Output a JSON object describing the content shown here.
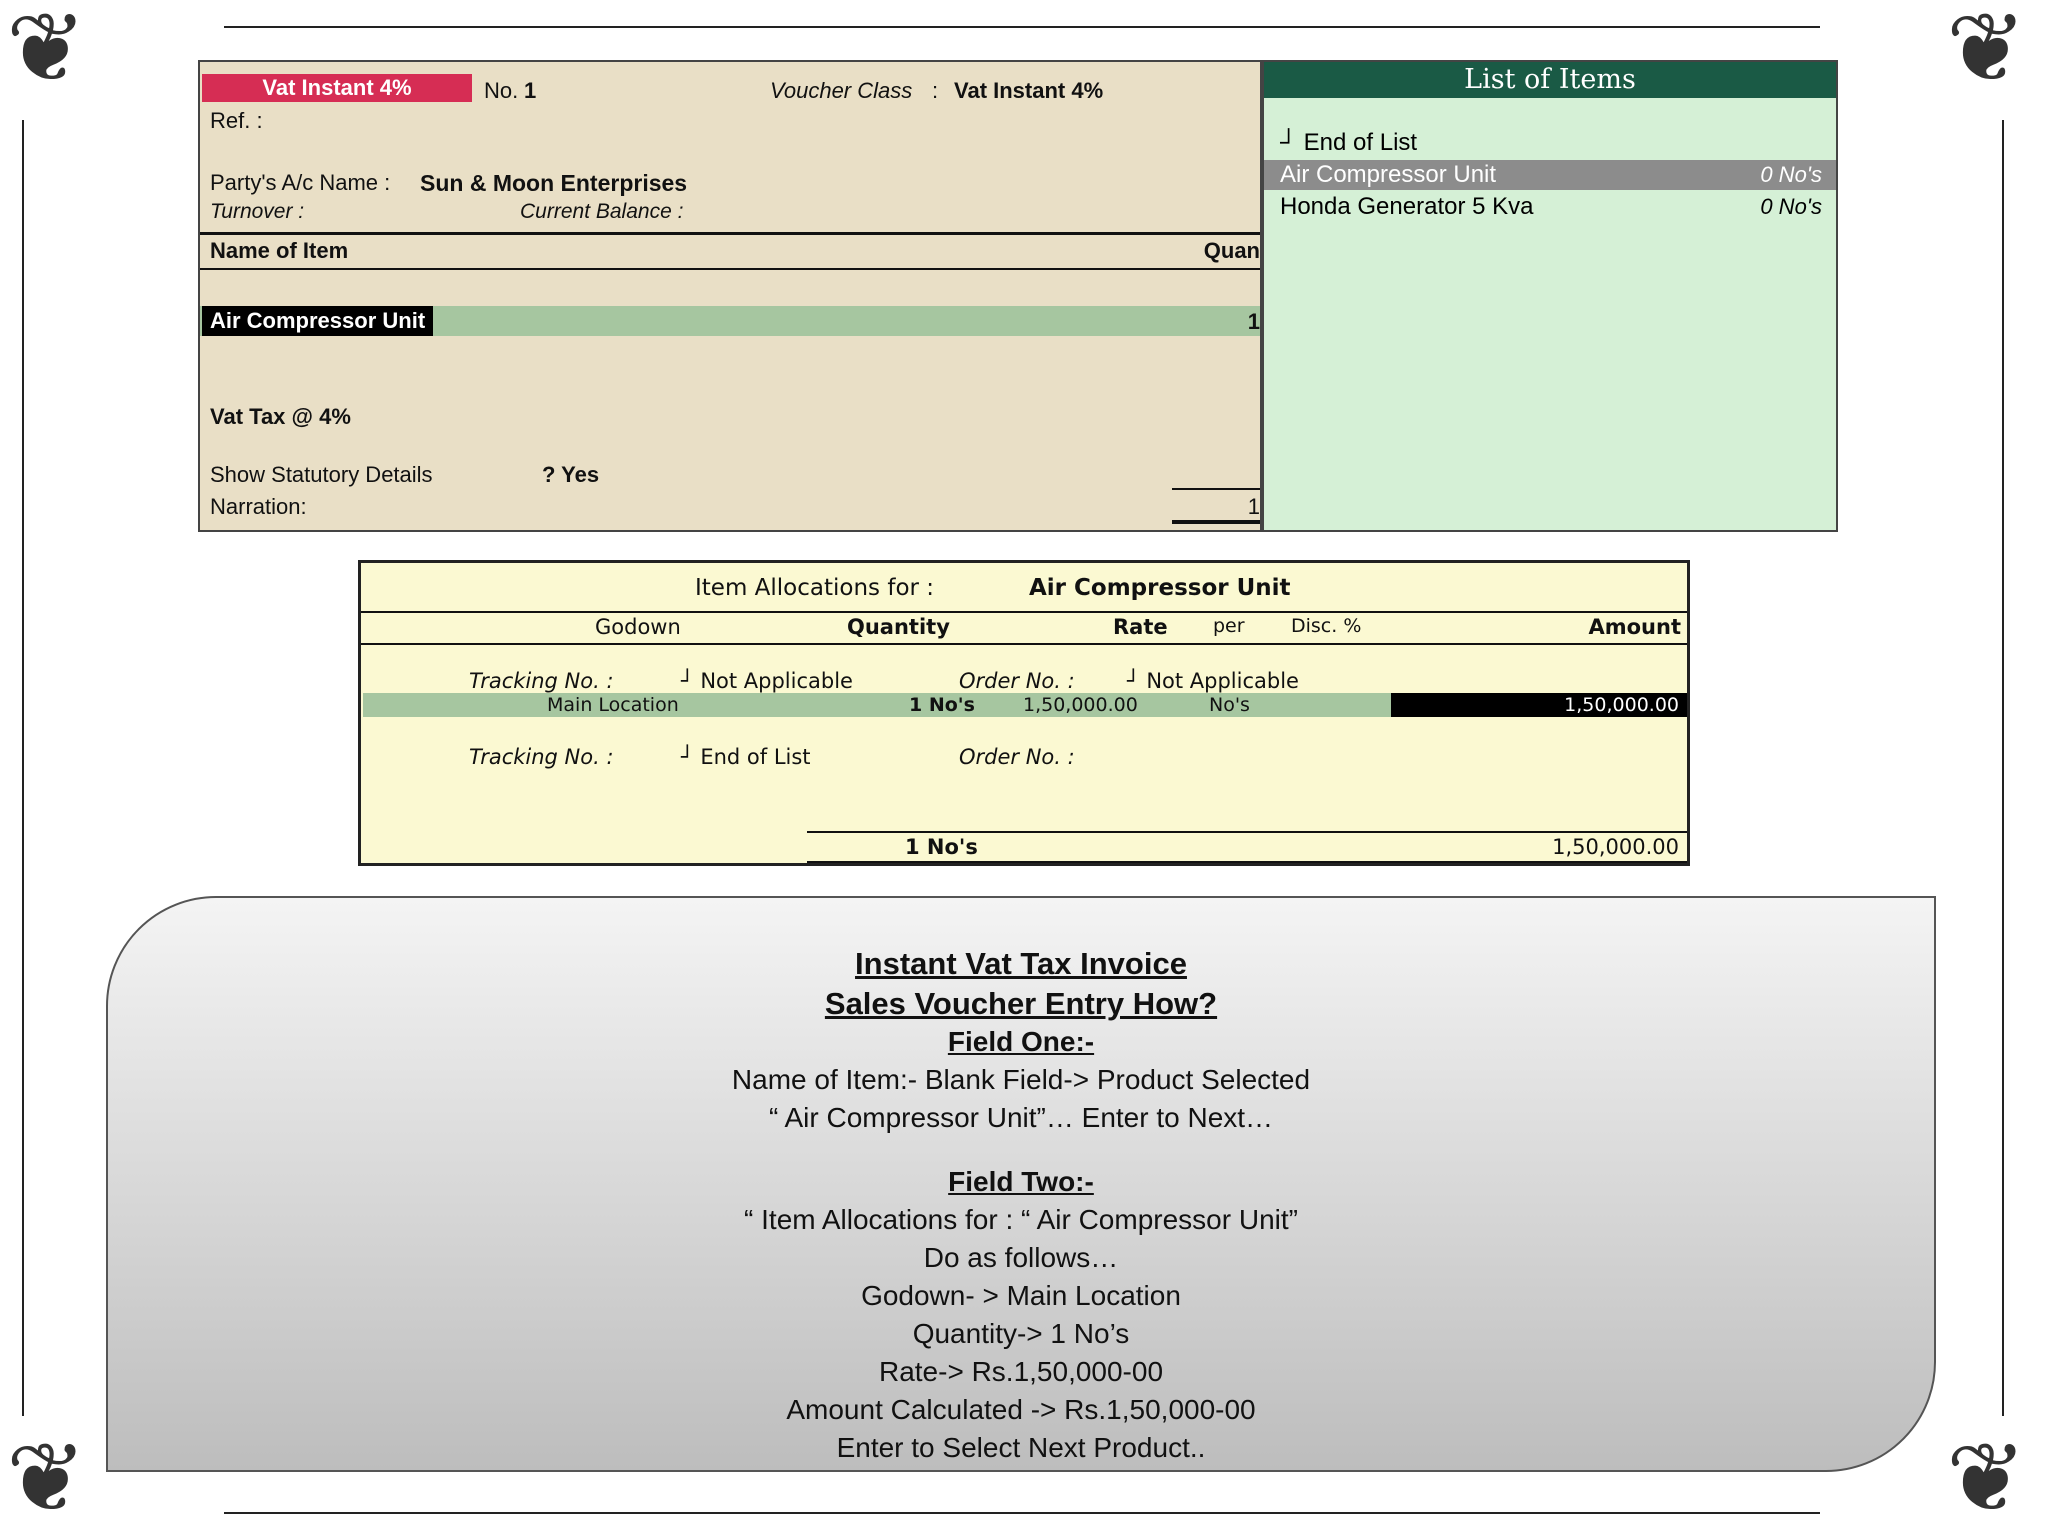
{
  "voucher": {
    "type_label": "Vat Instant 4%",
    "no_label": "No.",
    "no_value": "1",
    "voucher_class_label": "Voucher Class",
    "voucher_class_sep": ":",
    "voucher_class_value": "Vat Instant 4%",
    "ref_label": "Ref. :",
    "party_label": "Party's A/c Name :",
    "party_value": "Sun & Moon Enterprises",
    "turnover_label": "Turnover  :",
    "current_balance_label": "Current Balance  :",
    "col_name": "Name of Item",
    "col_qty": "Quan",
    "selected_item": "Air Compressor Unit",
    "selected_qty": "1",
    "tax_line": "Vat Tax @ 4%",
    "statutory_label": "Show Statutory Details",
    "statutory_value": "? Yes",
    "narration_label": "Narration:",
    "total_qty": "1"
  },
  "items_list": {
    "title": "List of Items",
    "items": [
      {
        "name": "┘ End of List",
        "qty": ""
      },
      {
        "name": "Air Compressor Unit",
        "qty": "0 No's"
      },
      {
        "name": "Honda Generator 5 Kva",
        "qty": "0 No's"
      }
    ]
  },
  "allocation": {
    "title_label": "Item Allocations for  :",
    "title_value": "Air Compressor Unit",
    "col_godown": "Godown",
    "col_quantity": "Quantity",
    "col_rate": "Rate",
    "col_per": "per",
    "col_disc": "Disc. %",
    "col_amount": "Amount",
    "tracking_label": "Tracking No. :",
    "tracking_value": "┘ Not Applicable",
    "order_label": "Order No. :",
    "order_value": "┘ Not Applicable",
    "row_godown": "Main Location",
    "row_qty": "1 No's",
    "row_rate": "1,50,000.00",
    "row_per": "No's",
    "row_amount": "1,50,000.00",
    "tracking2_label": "Tracking No. :",
    "tracking2_value": "┘ End of List",
    "order2_label": "Order No. :",
    "total_qty": "1 No's",
    "total_amount": "1,50,000.00"
  },
  "note": {
    "lines": [
      "Instant Vat Tax Invoice",
      "Sales Voucher Entry How?",
      "Field  One:-",
      "Name of Item:- Blank Field->  Product  Selected",
      "“ Air Compressor Unit”… Enter to Next…",
      "Field  Two:-",
      "“ Item Allocations for : “ Air Compressor Unit”",
      "Do as follows…",
      "Godown- > Main Location",
      "Quantity-> 1 No’s",
      "Rate-> Rs.1,50,000-00",
      "Amount Calculated -> Rs.1,50,000-00",
      "Enter to Select  Next   Product.."
    ]
  },
  "colors": {
    "voucher_bg": "#e9dfc6",
    "type_badge": "#d62d54",
    "list_bg": "#d5f0d6",
    "list_title": "#1a5a45",
    "highlight": "#a6c6a0",
    "alloc_bg": "#fbf9d2"
  }
}
